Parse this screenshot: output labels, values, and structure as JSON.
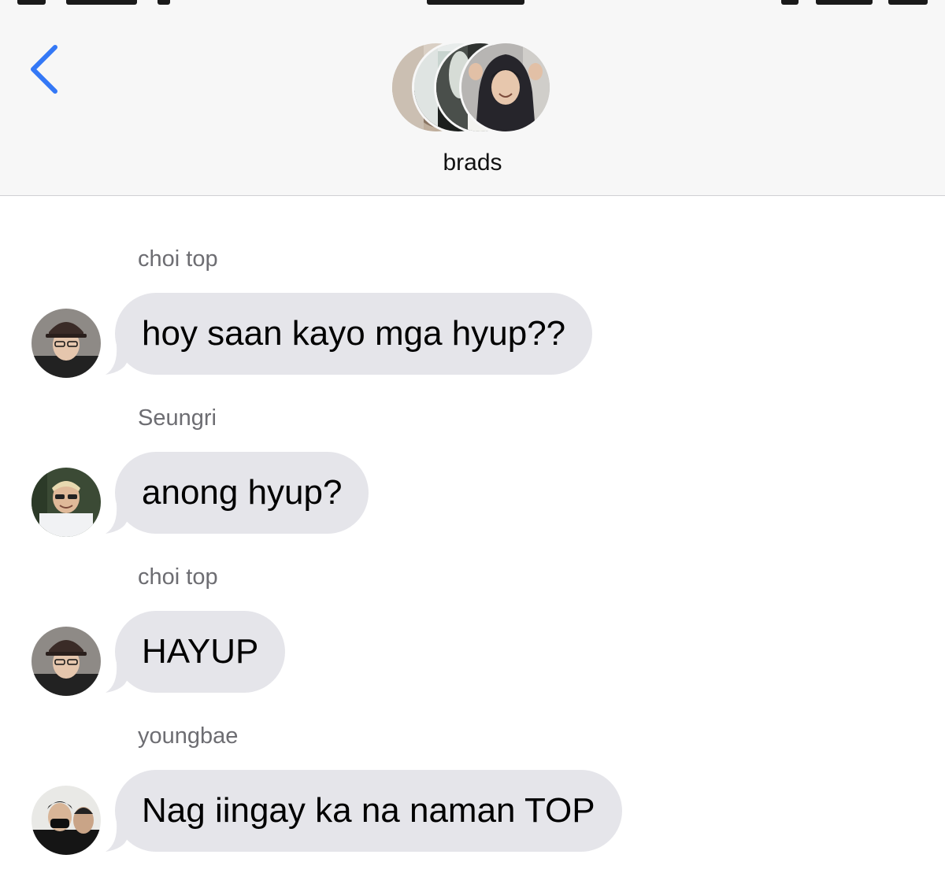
{
  "header": {
    "back_icon": "chevron-left-icon",
    "group_name": "brads",
    "accent_color": "#3478f6",
    "group_avatars": [
      "avatar-photo",
      "avatar-photo",
      "avatar-photo",
      "avatar-photo"
    ]
  },
  "messages": [
    {
      "sender": "choi top",
      "text": "hoy saan kayo mga hyup??"
    },
    {
      "sender": "Seungri",
      "text": "anong hyup?"
    },
    {
      "sender": "choi top",
      "text": "HAYUP"
    },
    {
      "sender": "youngbae",
      "text": "Nag iingay ka na naman TOP"
    }
  ],
  "colors": {
    "header_bg": "#f7f7f7",
    "bubble_bg": "#e5e5ea",
    "sender_text": "#6d6d72"
  }
}
